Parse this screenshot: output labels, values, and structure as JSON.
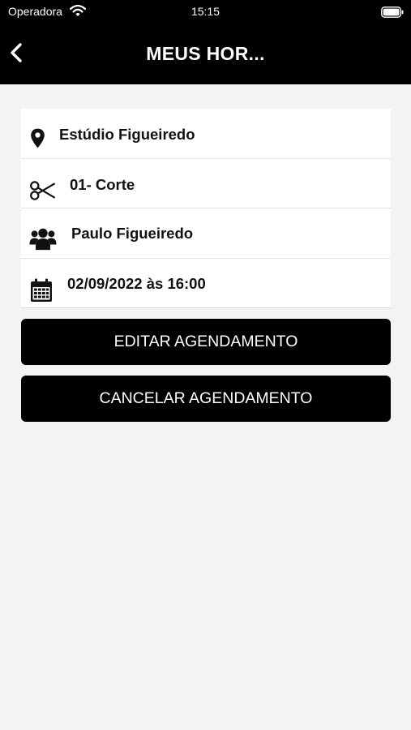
{
  "status_bar": {
    "carrier": "Operadora",
    "time": "15:15",
    "icons": [
      "wifi-icon",
      "battery-icon"
    ]
  },
  "header": {
    "title": "MEUS HOR...",
    "back_icon": "chevron-left-icon"
  },
  "appointment": {
    "rows": [
      {
        "icon": "location-pin-icon",
        "text": "Estúdio Figueiredo"
      },
      {
        "icon": "scissors-icon",
        "text": "01- Corte"
      },
      {
        "icon": "users-icon",
        "text": "Paulo Figueiredo"
      },
      {
        "icon": "calendar-icon",
        "text": "02/09/2022 às 16:00"
      }
    ]
  },
  "actions": {
    "edit_label": "EDITAR AGENDAMENTO",
    "cancel_label": "CANCELAR AGENDAMENTO"
  },
  "colors": {
    "bar_background": "#000000",
    "page_background": "#f3f3f3",
    "card_background": "#ffffff",
    "button_background": "#000000",
    "button_text": "#ffffff"
  }
}
